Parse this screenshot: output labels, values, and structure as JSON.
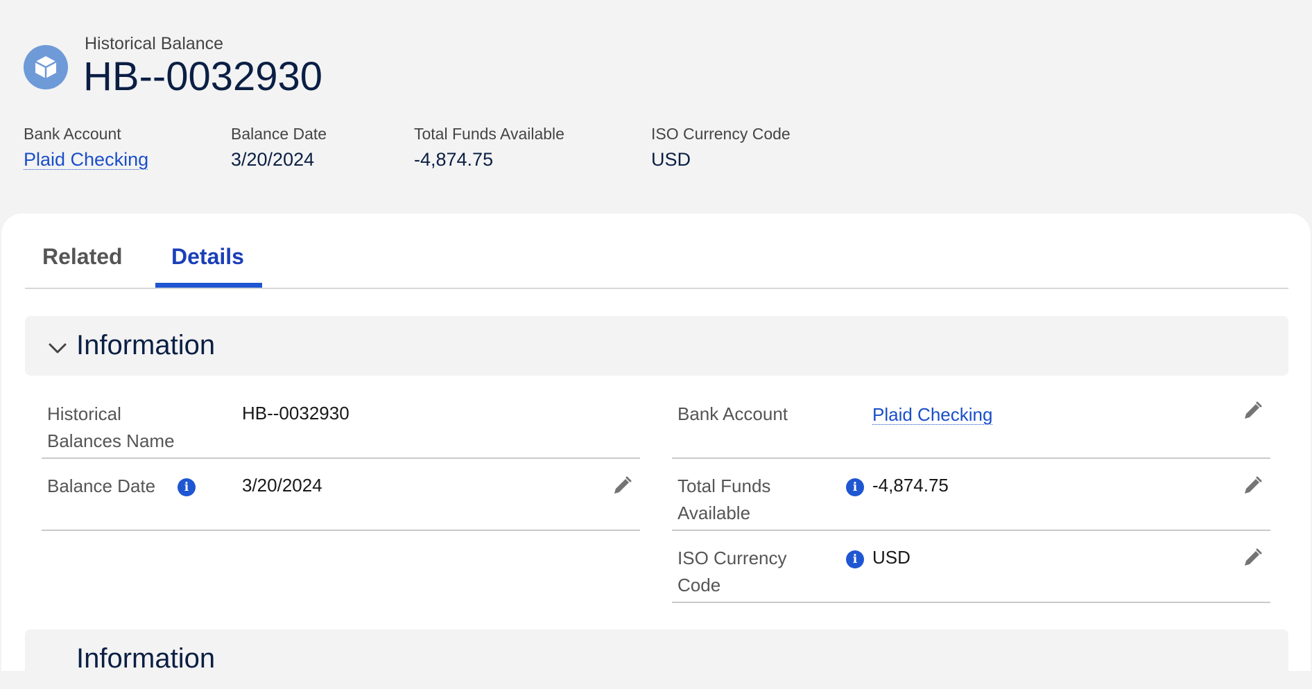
{
  "header": {
    "object_type": "Historical Balance",
    "record_name": "HB--0032930",
    "icon": "cube-icon",
    "icon_color": "#6e9ad8"
  },
  "highlights": [
    {
      "label": "Bank Account",
      "value": "Plaid Checking",
      "is_link": true
    },
    {
      "label": "Balance Date",
      "value": "3/20/2024"
    },
    {
      "label": "Total Funds Available",
      "value": "-4,874.75"
    },
    {
      "label": "ISO Currency Code",
      "value": "USD"
    }
  ],
  "tabs": [
    {
      "label": "Related",
      "active": false
    },
    {
      "label": "Details",
      "active": true
    }
  ],
  "sections": [
    {
      "title": "Information",
      "expanded": true
    },
    {
      "title": "Information"
    }
  ],
  "fields": {
    "historical_balances_name": {
      "label": "Historical Balances Name",
      "value": "HB--0032930"
    },
    "balance_date": {
      "label": "Balance Date",
      "value": "3/20/2024"
    },
    "bank_account": {
      "label": "Bank Account",
      "value": "Plaid Checking"
    },
    "total_funds_available": {
      "label": "Total Funds Available",
      "value": "-4,874.75"
    },
    "iso_currency_code": {
      "label": "ISO Currency Code",
      "value": "USD"
    }
  },
  "colors": {
    "link": "#1a4ec9",
    "active_tab": "#1f56d1",
    "title": "#0b1f44"
  }
}
